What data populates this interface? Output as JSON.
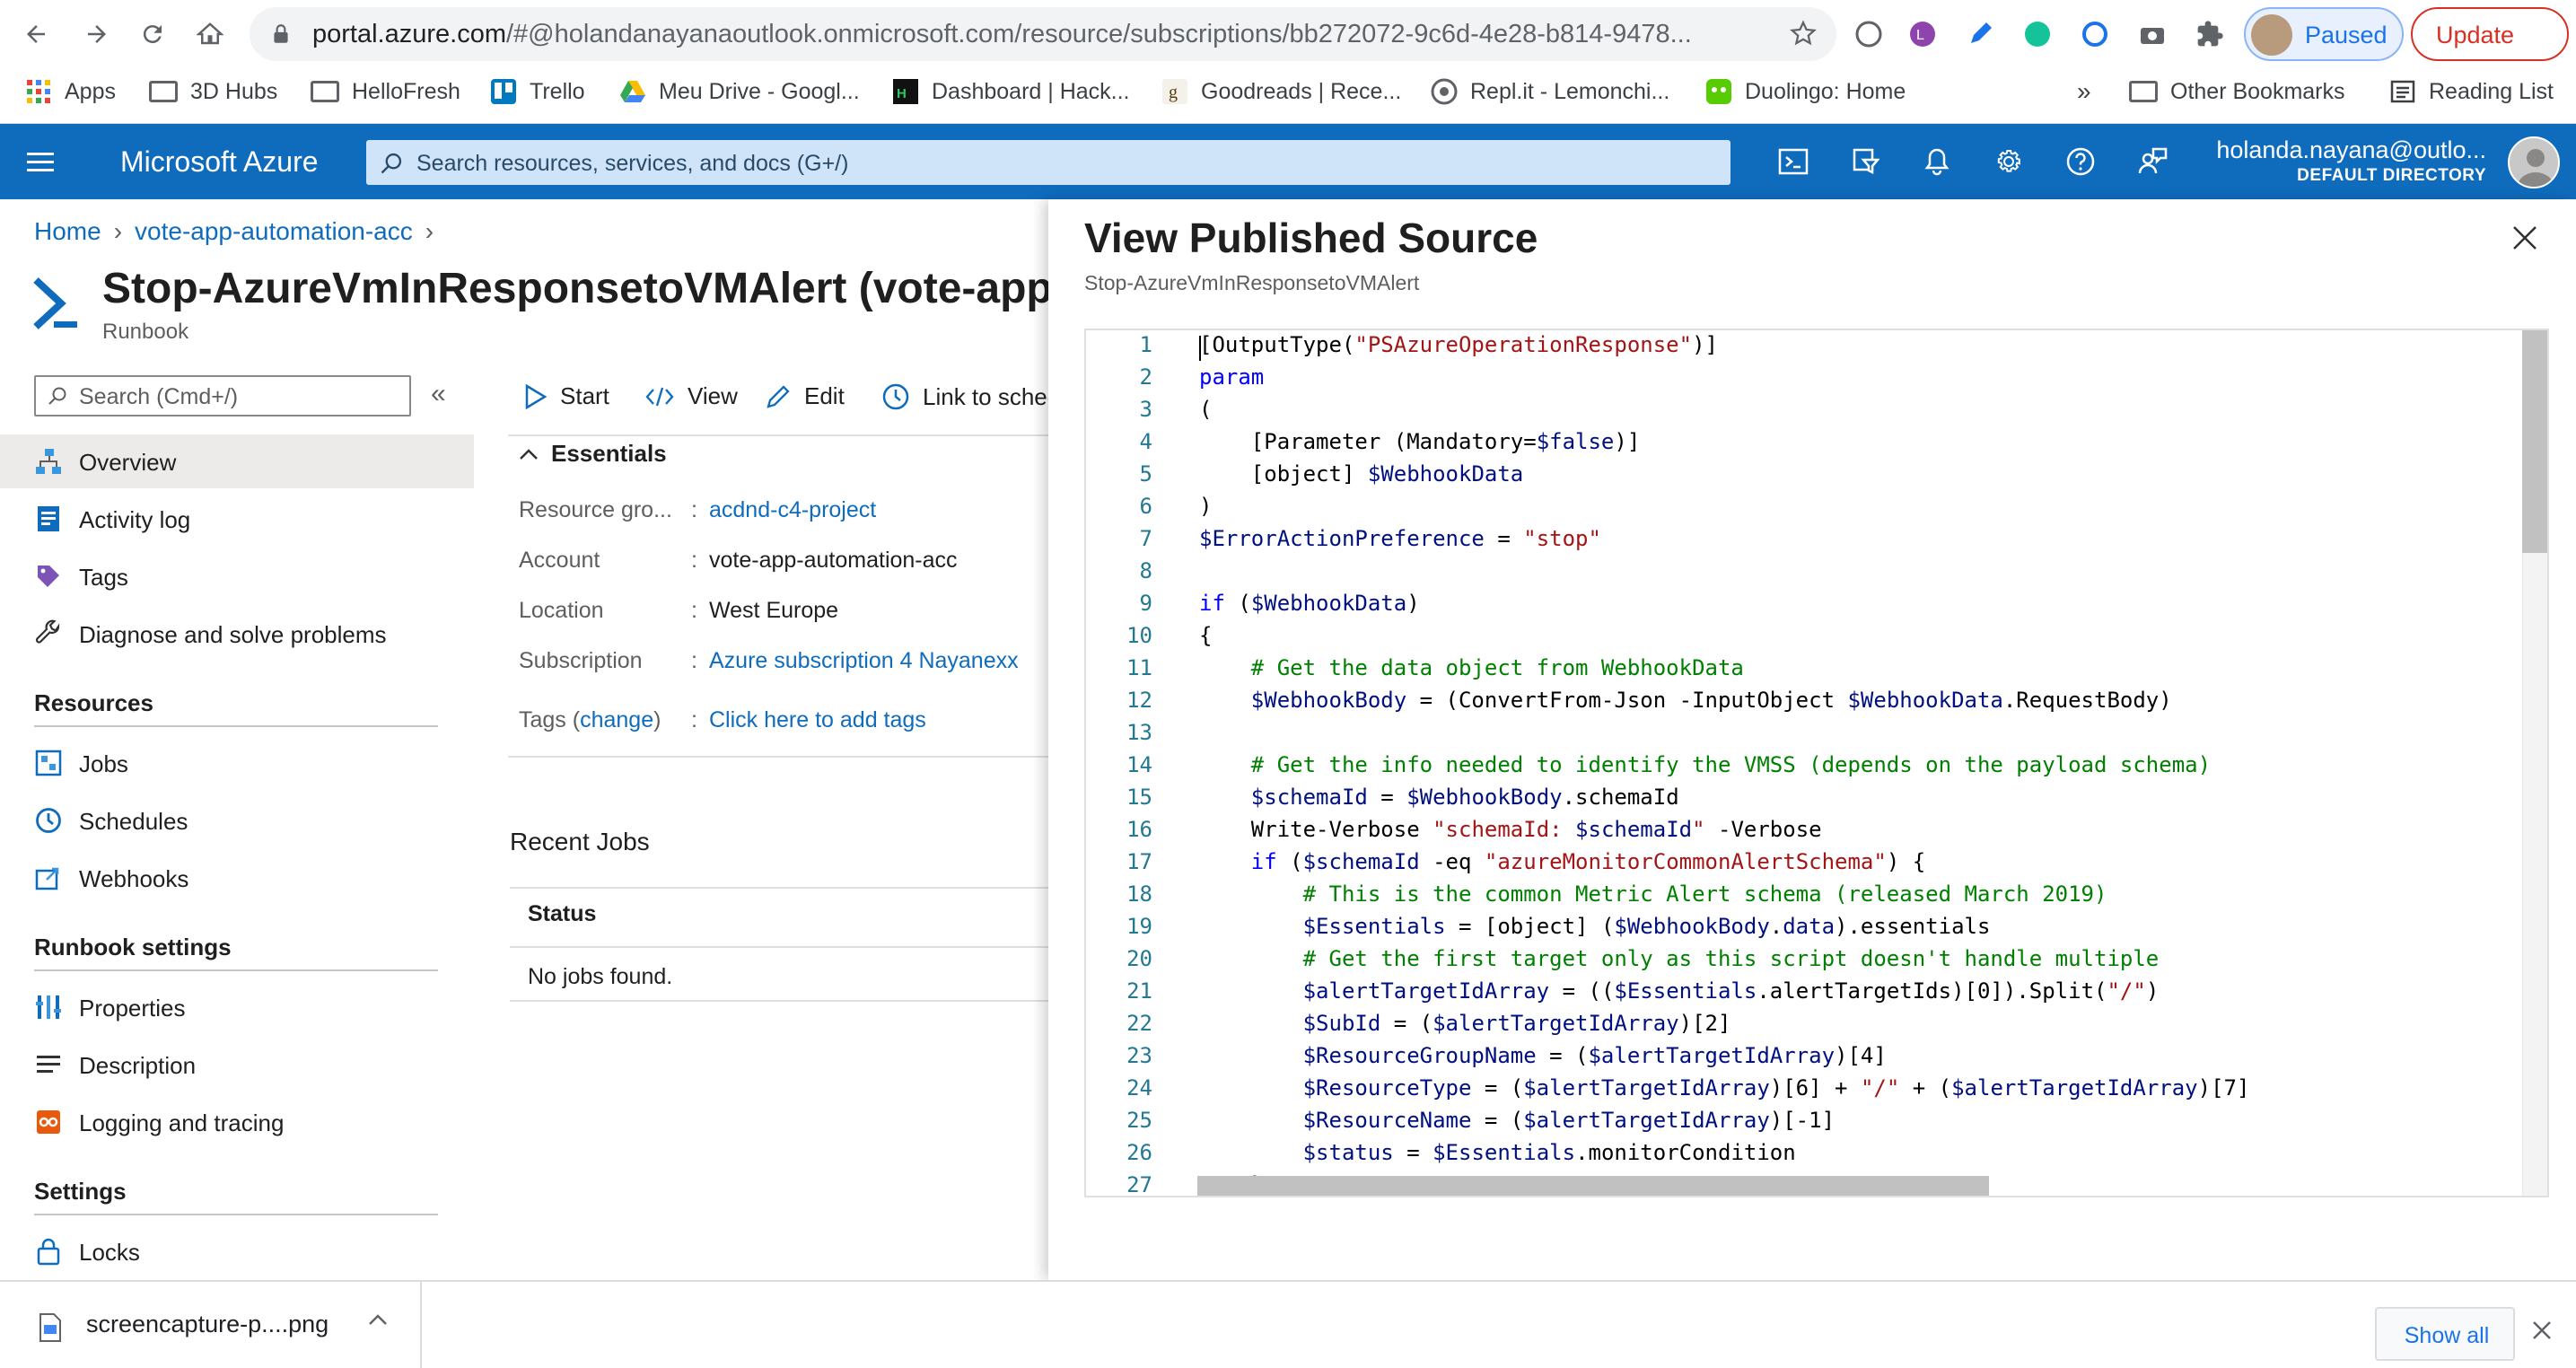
{
  "browser": {
    "url_main": "portal.azure.com",
    "url_rest": "/#@holandanayanaoutlook.onmicrosoft.com/resource/subscriptions/bb272072-9c6d-4e28-b814-9478...",
    "profile_label": "Paused",
    "update_label": "Update",
    "bookmarks": [
      {
        "label": "Apps"
      },
      {
        "label": "3D Hubs"
      },
      {
        "label": "HelloFresh"
      },
      {
        "label": "Trello"
      },
      {
        "label": "Meu Drive - Googl..."
      },
      {
        "label": "Dashboard | Hack..."
      },
      {
        "label": "Goodreads | Rece..."
      },
      {
        "label": "Repl.it - Lemonchi..."
      },
      {
        "label": "Duolingo: Home"
      }
    ],
    "overflow": "»",
    "other_bookmarks": "Other Bookmarks",
    "reading_list": "Reading List"
  },
  "azure": {
    "brand": "Microsoft Azure",
    "search_placeholder": "Search resources, services, and docs (G+/)",
    "account_user": "holanda.nayana@outlo...",
    "account_dir": "DEFAULT DIRECTORY"
  },
  "blade": {
    "breadcrumb": [
      "Home",
      "vote-app-automation-acc"
    ],
    "title": "Stop-AzureVmInResponsetoVMAlert (vote-app-a",
    "subtitle": "Runbook",
    "menu_search_placeholder": "Search (Cmd+/)",
    "menu": {
      "top": [
        "Overview",
        "Activity log",
        "Tags",
        "Diagnose and solve problems"
      ],
      "resources_title": "Resources",
      "resources": [
        "Jobs",
        "Schedules",
        "Webhooks"
      ],
      "runbook_settings_title": "Runbook settings",
      "runbook_settings": [
        "Properties",
        "Description",
        "Logging and tracing"
      ],
      "settings_title": "Settings",
      "settings": [
        "Locks"
      ]
    },
    "toolbar": {
      "start": "Start",
      "view": "View",
      "edit": "Edit",
      "link": "Link to sched"
    },
    "essentials_title": "Essentials",
    "essentials": {
      "resource_group_key": "Resource gro...",
      "resource_group_val": "acdnd-c4-project",
      "account_key": "Account",
      "account_val": "vote-app-automation-acc",
      "location_key": "Location",
      "location_val": "West Europe",
      "subscription_key": "Subscription",
      "subscription_val": "Azure subscription 4 Nayanexx",
      "tags_key": "Tags",
      "tags_change": "change",
      "tags_val": "Click here to add tags",
      "colon": ":"
    },
    "recent_jobs": "Recent Jobs",
    "jobs_status_header": "Status",
    "jobs_empty": "No jobs found."
  },
  "panel": {
    "title": "View Published Source",
    "subtitle": "Stop-AzureVmInResponsetoVMAlert",
    "code_lines": [
      "[OutputType(\"PSAzureOperationResponse\")]",
      "param",
      "(",
      "    [Parameter (Mandatory=$false)]",
      "    [object] $WebhookData",
      ")",
      "$ErrorActionPreference = \"stop\"",
      "",
      "if ($WebhookData)",
      "{",
      "    # Get the data object from WebhookData",
      "    $WebhookBody = (ConvertFrom-Json -InputObject $WebhookData.RequestBody)",
      "",
      "    # Get the info needed to identify the VMSS (depends on the payload schema)",
      "    $schemaId = $WebhookBody.schemaId",
      "    Write-Verbose \"schemaId: $schemaId\" -Verbose",
      "    if ($schemaId -eq \"azureMonitorCommonAlertSchema\") {",
      "        # This is the common Metric Alert schema (released March 2019)",
      "        $Essentials = [object] ($WebhookBody.data).essentials",
      "        # Get the first target only as this script doesn't handle multiple",
      "        $alertTargetIdArray = (($Essentials.alertTargetIds)[0]).Split(\"/\")",
      "        $SubId = ($alertTargetIdArray)[2]",
      "        $ResourceGroupName = ($alertTargetIdArray)[4]",
      "        $ResourceType = ($alertTargetIdArray)[6] + \"/\" + ($alertTargetIdArray)[7]",
      "        $ResourceName = ($alertTargetIdArray)[-1]",
      "        $status = $Essentials.monitorCondition",
      "    }"
    ]
  },
  "downloads": {
    "file": "screencapture-p....png",
    "show_all": "Show all"
  },
  "colors": {
    "azure_blue": "#0f6cbd",
    "link_blue": "#0f6cbd",
    "string_red": "#a31515",
    "variable_navy": "#001080",
    "keyword_blue": "#0000ff",
    "comment_green": "#008000"
  }
}
